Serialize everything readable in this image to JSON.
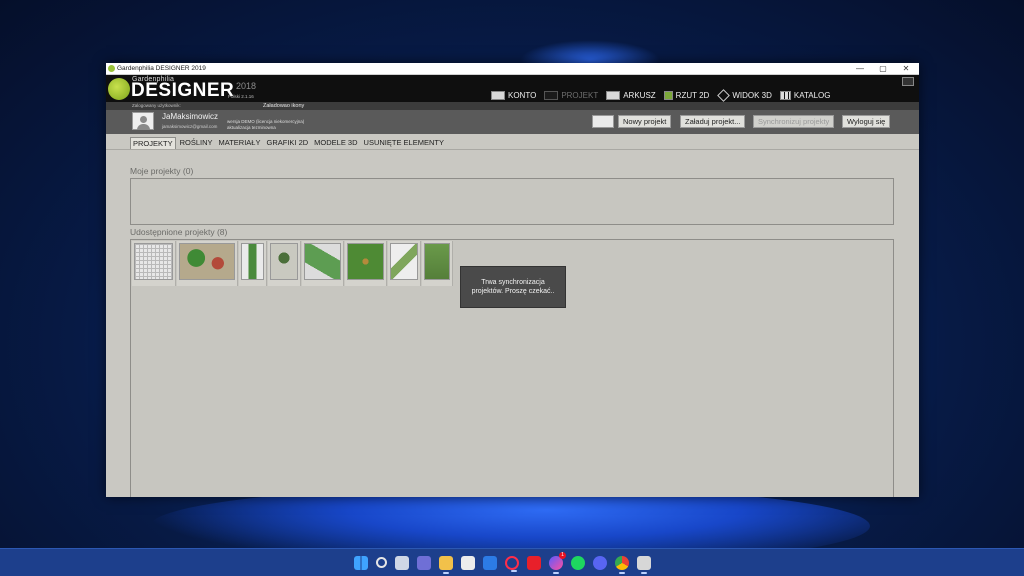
{
  "window": {
    "title": "Gardenphilia DESIGNER 2019",
    "controls": {
      "minimize": "—",
      "maximize": "▢",
      "close": "✕"
    }
  },
  "logo": {
    "small": "Gardenphilia",
    "big": "DESIGNER",
    "year": "2018",
    "version": "Polski 2.1.16"
  },
  "nav": [
    {
      "label": "KONTO",
      "state": "active"
    },
    {
      "label": "PROJEKT",
      "state": "disabled"
    },
    {
      "label": "ARKUSZ",
      "state": "normal"
    },
    {
      "label": "RZUT 2D",
      "state": "normal"
    },
    {
      "label": "WIDOK 3D",
      "state": "normal"
    },
    {
      "label": "KATALOG",
      "state": "normal"
    }
  ],
  "infobar": {
    "logged_in": "Zalogowany użytkownik:",
    "loading": "Załadowao ikony"
  },
  "user": {
    "name": "JaMaksimowicz",
    "email": "jamaksimowicz@gmail.com",
    "licence_line1": "wersja DEMO (licencja niekomercyjna)",
    "licence_line2": "aktualizacja tezminowna"
  },
  "buttons": {
    "new_project": "Nowy projekt",
    "load_project": "Załaduj projekt...",
    "sync_projects": "Synchronizuj projekty",
    "logout": "Wyloguj się"
  },
  "tabs": [
    "PROJEKTY",
    "ROŚLINY",
    "MATERIAŁY",
    "GRAFIKI 2D",
    "MODELE 3D",
    "USUNIĘTE ELEMENTY"
  ],
  "sections": {
    "my_projects": "Moje projekty (0)",
    "shared_projects": "Udostępnione projekty (8)"
  },
  "toast": {
    "line1": "Trwa synchronizacja",
    "line2": "projektów. Proszę czekać.."
  },
  "taskbar": {
    "icons": [
      "windows-start",
      "search",
      "task-view",
      "teams-chat",
      "file-explorer",
      "microsoft-store",
      "mail",
      "opera",
      "wps-office",
      "messenger",
      "spotify",
      "discord",
      "chrome",
      "gardenphilia-app"
    ],
    "messenger_badge": "1"
  }
}
